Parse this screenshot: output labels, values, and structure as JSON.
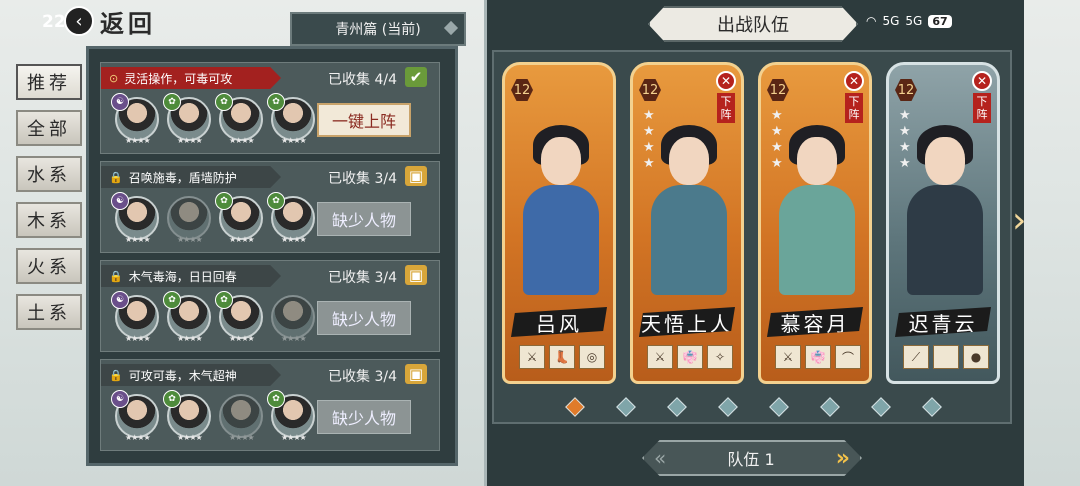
{
  "status": {
    "time": "22:",
    "battery": "67",
    "signal1": "5G",
    "signal2": "5G"
  },
  "header": {
    "back_label": "返回",
    "chapter": "青州篇 (当前)"
  },
  "categories": [
    "推荐",
    "全部",
    "水系",
    "木系",
    "火系",
    "土系"
  ],
  "combos": [
    {
      "tag": "灵活操作，可毒可攻",
      "collected": "已收集 4/4",
      "action": "一键上阵",
      "complete": true,
      "avatars": [
        {
          "badge": "☯"
        },
        {
          "badge": "🌿"
        },
        {
          "badge": "🌿"
        },
        {
          "badge": "🌿"
        }
      ]
    },
    {
      "tag": "召唤施毒，盾墙防护",
      "collected": "已收集 3/4",
      "action": "缺少人物",
      "complete": false,
      "avatars": [
        {
          "badge": "☯"
        },
        {
          "badge": ""
        },
        {
          "badge": "🌿"
        },
        {
          "badge": "🌿"
        }
      ]
    },
    {
      "tag": "木气毒海，日日回春",
      "collected": "已收集 3/4",
      "action": "缺少人物",
      "complete": false,
      "avatars": [
        {
          "badge": "☯"
        },
        {
          "badge": "🌿"
        },
        {
          "badge": "🌿"
        },
        {
          "badge": ""
        }
      ]
    },
    {
      "tag": "可攻可毒，木气超神",
      "collected": "已收集 3/4",
      "action": "缺少人物",
      "complete": false,
      "avatars": [
        {
          "badge": "☯"
        },
        {
          "badge": "🌿"
        },
        {
          "badge": ""
        },
        {
          "badge": "🌿"
        }
      ]
    }
  ],
  "team": {
    "title": "出战队伍",
    "remove_label": "下阵",
    "members": [
      {
        "name": "吕风",
        "level": "12",
        "stars": 0,
        "removable": false,
        "equip": [
          "⚔",
          "👢",
          "◎"
        ]
      },
      {
        "name": "天悟上人",
        "level": "12",
        "stars": 4,
        "removable": true,
        "equip": [
          "⚔",
          "👘",
          "✧"
        ]
      },
      {
        "name": "慕容月",
        "level": "12",
        "stars": 4,
        "removable": true,
        "equip": [
          "⚔",
          "👘",
          "⌒"
        ]
      },
      {
        "name": "迟青云",
        "level": "12",
        "stars": 4,
        "removable": true,
        "equip": [
          "⟋",
          "",
          "●"
        ]
      }
    ],
    "page_count": 8,
    "active_page": 0,
    "nav_label": "队伍 1"
  },
  "colors": {
    "accent": "#e07b2a",
    "panel": "#2f3d3f",
    "danger": "#b5221d"
  }
}
